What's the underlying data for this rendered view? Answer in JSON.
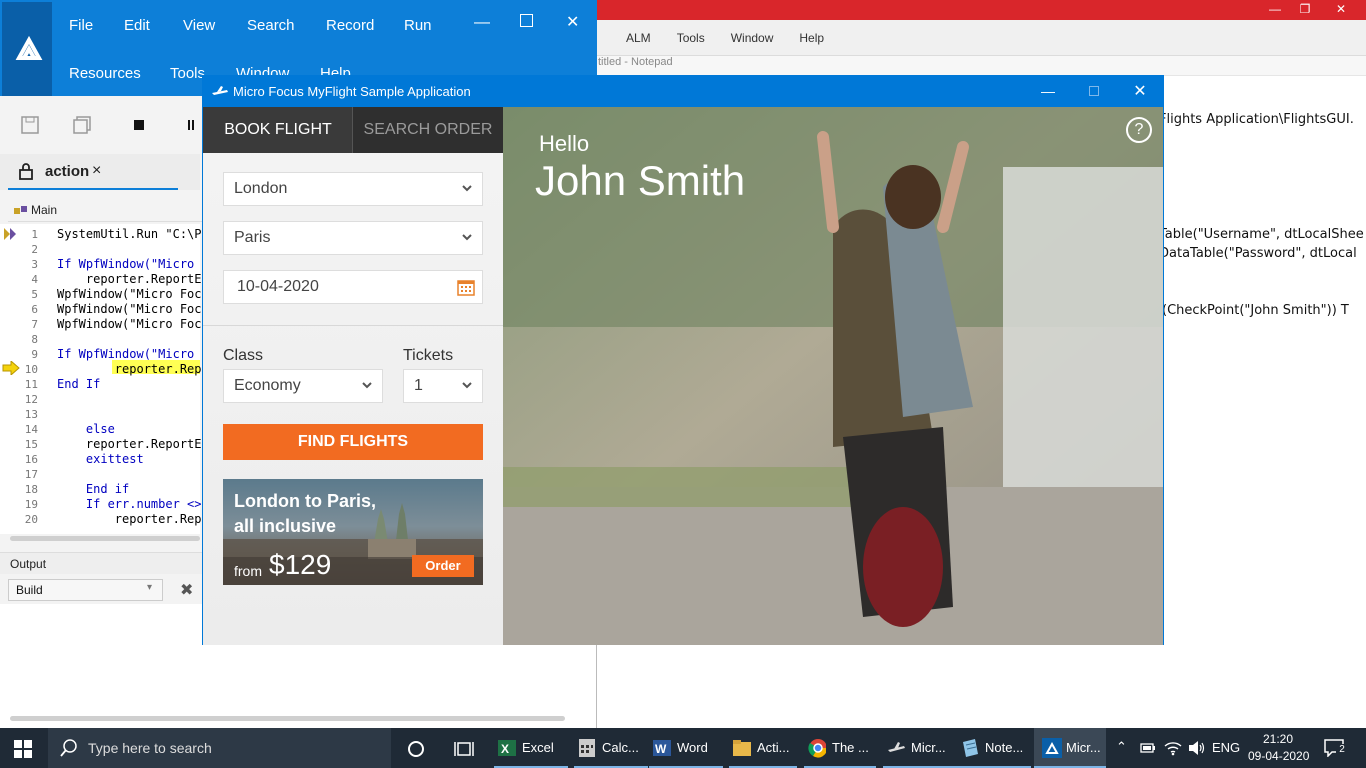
{
  "uft": {
    "menu": [
      "File",
      "Edit",
      "View",
      "Search",
      "Record",
      "Run",
      "Resources",
      "Tools",
      "Window",
      "Help"
    ],
    "tab_label": "action",
    "tab_close": "×",
    "breadcrumb": "Main",
    "lines": [
      {
        "n": "1",
        "text": "SystemUtil.Run \"C:\\Pr"
      },
      {
        "n": "2",
        "text": ""
      },
      {
        "n": "3",
        "text": "If WpfWindow(\"Micro F"
      },
      {
        "n": "4",
        "text": "    reporter.ReportEv"
      },
      {
        "n": "5",
        "text": "WpfWindow(\"Micro Focu"
      },
      {
        "n": "6",
        "text": "WpfWindow(\"Micro Focu"
      },
      {
        "n": "7",
        "text": "WpfWindow(\"Micro Focu"
      },
      {
        "n": "8",
        "text": ""
      },
      {
        "n": "9",
        "text": "If WpfWindow(\"Micro F"
      },
      {
        "n": "10",
        "text": "        reporter.Repo"
      },
      {
        "n": "11",
        "text": "End If"
      },
      {
        "n": "12",
        "text": ""
      },
      {
        "n": "13",
        "text": ""
      },
      {
        "n": "14",
        "text": "    else"
      },
      {
        "n": "15",
        "text": "    reporter.ReportEv"
      },
      {
        "n": "16",
        "text": "    exittest"
      },
      {
        "n": "17",
        "text": ""
      },
      {
        "n": "18",
        "text": "    End if"
      },
      {
        "n": "19",
        "text": "    If err.number <>"
      },
      {
        "n": "20",
        "text": "        reporter.Repo"
      }
    ],
    "output_label": "Output",
    "build_select": "Build"
  },
  "background": {
    "menu": [
      "ALM",
      "Tools",
      "Window",
      "Help"
    ],
    "notepad_title": "titled - Notepad",
    "code_lines": [
      "Flights Application\\FlightsGUI.",
      "Table(\"Username\", dtLocalShee",
      "DataTable(\"Password\", dtLocal",
      "(CheckPoint(\"John Smith\")) T"
    ]
  },
  "flight": {
    "window_title": "Micro Focus MyFlight Sample Application",
    "tab_book": "BOOK FLIGHT",
    "tab_search": "SEARCH ORDER",
    "from_city": "London",
    "to_city": "Paris",
    "date": "10-04-2020",
    "class_label": "Class",
    "class_value": "Economy",
    "tickets_label": "Tickets",
    "tickets_value": "1",
    "find_button": "FIND FLIGHTS",
    "promo_title_line1": "London to Paris,",
    "promo_title_line2": "all inclusive",
    "promo_from": "from",
    "promo_price": "$129",
    "promo_order": "Order",
    "greeting": "Hello",
    "user_name": "John Smith",
    "help": "?"
  },
  "taskbar": {
    "search_placeholder": "Type here to search",
    "apps": [
      "Excel",
      "Calc...",
      "Word",
      "Acti...",
      "The ...",
      "Micr...",
      "Note...",
      "Micr..."
    ],
    "lang": "ENG",
    "time": "21:20",
    "date": "09-04-2020",
    "notifications": "2"
  },
  "colors": {
    "accent_blue": "#0078d7",
    "orange": "#f26b21",
    "tab_dark": "#2f2f2f"
  }
}
